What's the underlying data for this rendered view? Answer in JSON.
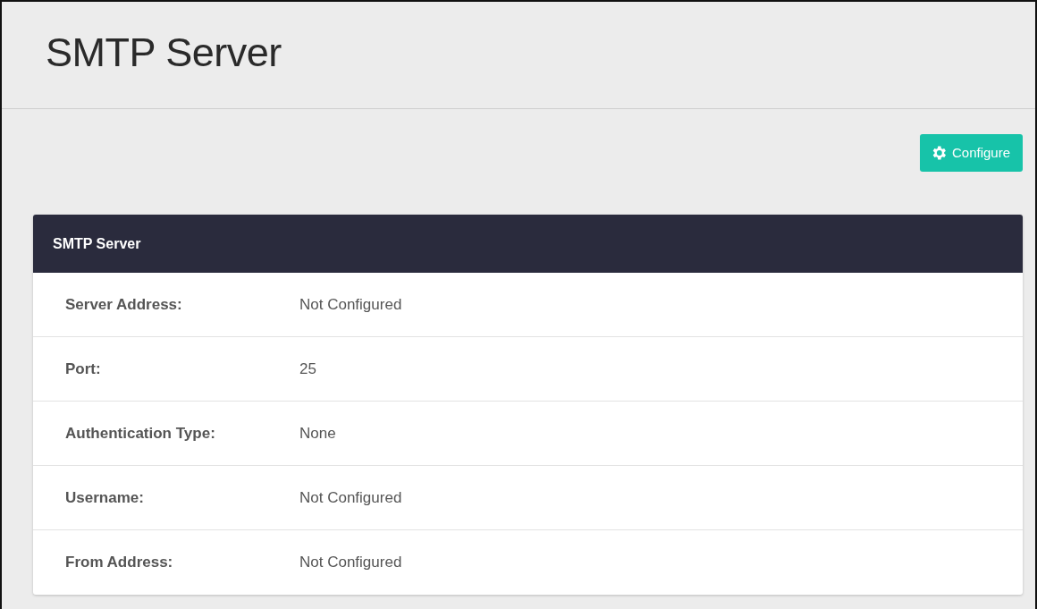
{
  "page_title": "SMTP Server",
  "configure_button": {
    "label": "Configure"
  },
  "panel": {
    "title": "SMTP Server",
    "rows": [
      {
        "label": "Server Address:",
        "value": "Not Configured"
      },
      {
        "label": "Port:",
        "value": "25"
      },
      {
        "label": "Authentication Type:",
        "value": "None"
      },
      {
        "label": "Username:",
        "value": "Not Configured"
      },
      {
        "label": "From Address:",
        "value": "Not Configured"
      }
    ]
  }
}
